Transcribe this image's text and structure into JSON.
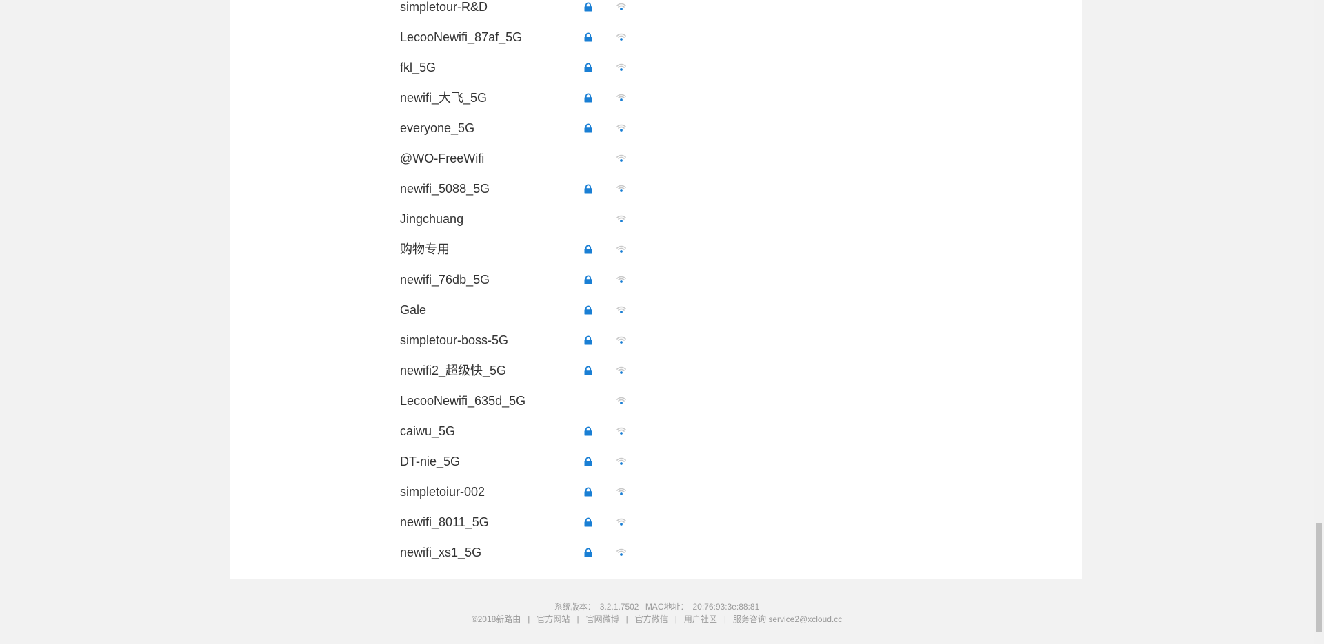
{
  "networks": [
    {
      "ssid": "simpletour-R&D",
      "locked": true
    },
    {
      "ssid": "LecooNewifi_87af_5G",
      "locked": true
    },
    {
      "ssid": "fkl_5G",
      "locked": true
    },
    {
      "ssid": "newifi_大飞_5G",
      "locked": true
    },
    {
      "ssid": "everyone_5G",
      "locked": true
    },
    {
      "ssid": "@WO-FreeWifi",
      "locked": false
    },
    {
      "ssid": "newifi_5088_5G",
      "locked": true
    },
    {
      "ssid": "Jingchuang",
      "locked": false
    },
    {
      "ssid": "购物专用",
      "locked": true
    },
    {
      "ssid": "newifi_76db_5G",
      "locked": true
    },
    {
      "ssid": "Gale",
      "locked": true
    },
    {
      "ssid": "simpletour-boss-5G",
      "locked": true
    },
    {
      "ssid": "newifi2_超级快_5G",
      "locked": true
    },
    {
      "ssid": "LecooNewifi_635d_5G",
      "locked": false
    },
    {
      "ssid": "caiwu_5G",
      "locked": true
    },
    {
      "ssid": "DT-nie_5G",
      "locked": true
    },
    {
      "ssid": "simpletoiur-002",
      "locked": true
    },
    {
      "ssid": "newifi_8011_5G",
      "locked": true
    },
    {
      "ssid": "newifi_xs1_5G",
      "locked": true
    }
  ],
  "colors": {
    "lock": "#1a7fd4",
    "signal_arc": "#c8c8c8",
    "signal_dot": "#1a7fd4"
  },
  "icons": {
    "lock": "lock-icon",
    "signal": "wifi-signal-icon"
  },
  "footer": {
    "version_label": "系统版本：",
    "version_value": "3.2.1.7502",
    "mac_label": "MAC地址：",
    "mac_value": "20:76:93:3e:88:81",
    "copyright": "©2018新路由",
    "links": [
      "官方网站",
      "官网微博",
      "官方微信",
      "用户社区"
    ],
    "service_label": "服务咨询",
    "service_email": "service2@xcloud.cc"
  }
}
